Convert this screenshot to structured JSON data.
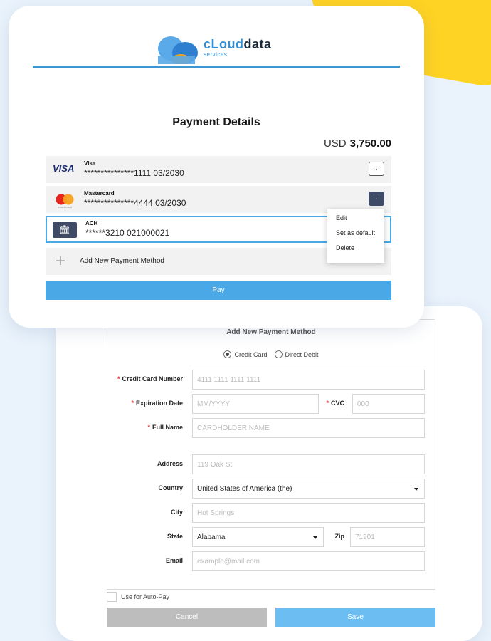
{
  "logo": {
    "brand_a": "cLoud",
    "brand_b": "data",
    "sub": "services"
  },
  "payment": {
    "title": "Payment Details",
    "currency": "USD",
    "amount": "3,750.00",
    "methods": [
      {
        "type": "visa",
        "logo": "VISA",
        "name": "Visa",
        "detail": "***************1111 03/2030",
        "icon": "visa-logo"
      },
      {
        "type": "mastercard",
        "logo": "mastercard",
        "name": "Mastercard",
        "detail": "***************4444 03/2030",
        "icon": "mastercard-logo"
      },
      {
        "type": "ach",
        "name": "ACH",
        "detail": "******3210 021000021",
        "icon": "bank-icon"
      }
    ],
    "more_label": "…",
    "add_label": "Add New Payment Method",
    "pay_label": "Pay",
    "menu": [
      "Edit",
      "Set as default",
      "Delete"
    ]
  },
  "form": {
    "title": "Add New Payment Method",
    "options": [
      "Credit Card",
      "Direct Debit"
    ],
    "selected_option": "Credit Card",
    "fields": {
      "card_number": {
        "label": "Credit Card Number",
        "placeholder": "4111 1111 1111 1111",
        "required": true
      },
      "expiration": {
        "label": "Expiration Date",
        "placeholder": "MM/YYYY",
        "required": true
      },
      "cvc": {
        "label": "CVC",
        "placeholder": "000",
        "required": true
      },
      "full_name": {
        "label": "Full Name",
        "placeholder": "CARDHOLDER NAME",
        "required": true
      },
      "address": {
        "label": "Address",
        "placeholder": "119 Oak St"
      },
      "country": {
        "label": "Country",
        "value": "United States of America (the)"
      },
      "city": {
        "label": "City",
        "placeholder": "Hot Springs"
      },
      "state": {
        "label": "State",
        "value": "Alabama"
      },
      "zip": {
        "label": "Zip",
        "placeholder": "71901"
      },
      "email": {
        "label": "Email",
        "placeholder": "example@mail.com"
      }
    },
    "required_mark": "*",
    "autopay_label": "Use for Auto-Pay",
    "cancel_label": "Cancel",
    "save_label": "Save"
  },
  "colors": {
    "accent": "#4aa8e6",
    "yellow": "#ffd324",
    "dark": "#3e4a66"
  }
}
